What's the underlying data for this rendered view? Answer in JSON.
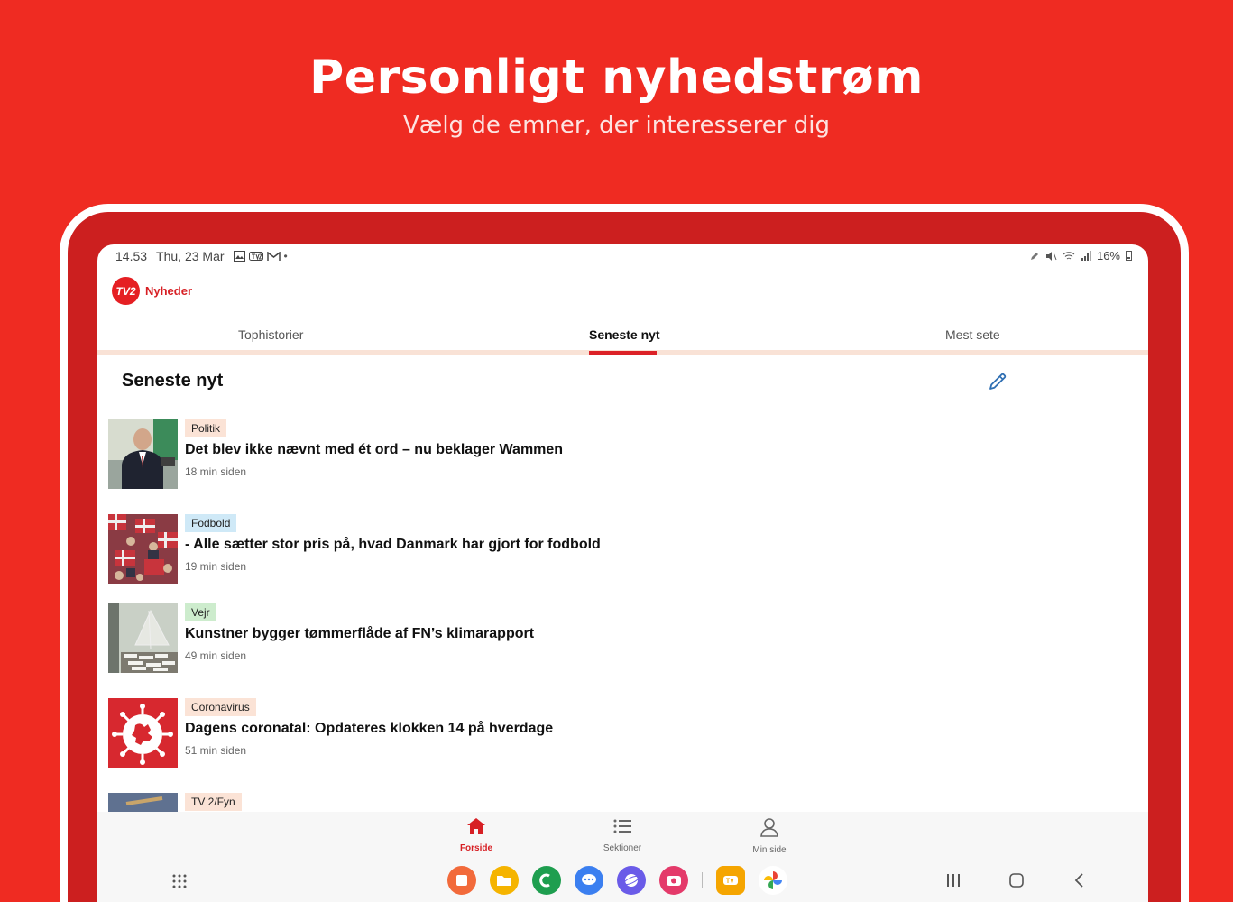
{
  "hero": {
    "title": "Personligt nyhedstrøm",
    "subtitle": "Vælg de emner, der interesserer dig"
  },
  "statusbar": {
    "time": "14.53",
    "date": "Thu, 23 Mar",
    "battery": "16%"
  },
  "app": {
    "logo_badge": "TV2",
    "logo_text": "Nyheder"
  },
  "tabs": [
    {
      "label": "Tophistorier"
    },
    {
      "label": "Seneste nyt"
    },
    {
      "label": "Mest sete"
    }
  ],
  "section": {
    "title": "Seneste nyt"
  },
  "articles": [
    {
      "tag": "Politik",
      "tag_color": "#fbe3d6",
      "headline": "Det blev ikke nævnt med ét ord – nu beklager Wammen",
      "time": "18 min siden"
    },
    {
      "tag": "Fodbold",
      "tag_color": "#cfe9f7",
      "headline": "- Alle sætter stor pris på, hvad Danmark har gjort for fodbold",
      "time": "19 min siden"
    },
    {
      "tag": "Vejr",
      "tag_color": "#cdeccd",
      "headline": "Kunstner bygger tømmerflåde af FN’s klimarapport",
      "time": "49 min siden"
    },
    {
      "tag": "Coronavirus",
      "tag_color": "#fbe3d6",
      "headline": "Dagens coronatal: Opdateres klokken 14 på hverdage",
      "time": "51 min siden"
    },
    {
      "tag": "TV 2/Fyn",
      "tag_color": "#fbe3d6"
    }
  ],
  "bottom_nav": [
    {
      "label": "Forside",
      "icon": "home-icon"
    },
    {
      "label": "Sektioner",
      "icon": "list-icon"
    },
    {
      "label": "Min side",
      "icon": "person-icon"
    }
  ],
  "colors": {
    "brand_red": "#ef2b22",
    "accent_red": "#dc2127"
  }
}
